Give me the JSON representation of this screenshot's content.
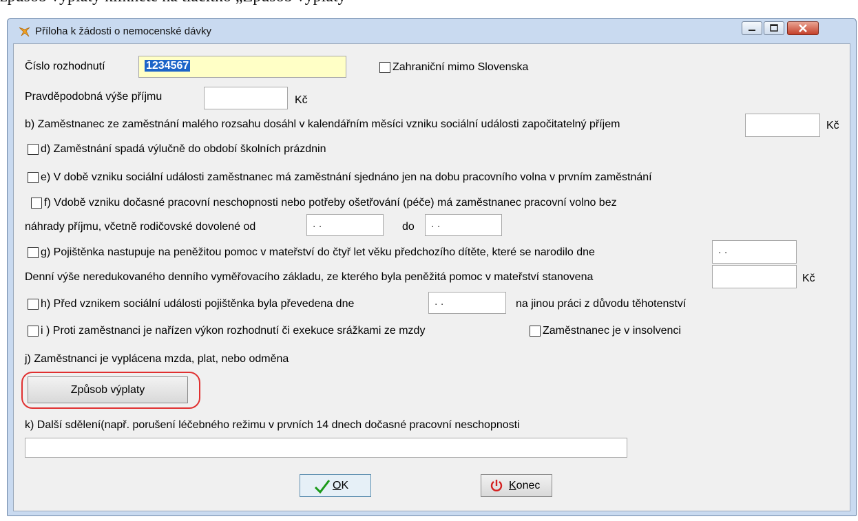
{
  "document_caption": "způsob výplaty klikněte na tlačítko „Způsob výplaty“",
  "window": {
    "title": "Příloha k žádosti o nemocenské dávky",
    "icon": "app-icon"
  },
  "form": {
    "cislo_rozhodnuti_label": "Číslo rozhodnutí",
    "cislo_rozhodnuti_value": "1234567",
    "zahranicni_label": "Zahraniční mimo Slovenska",
    "pravdepodobna_label": "Pravděpodobná výše příjmu",
    "pravdepodobna_unit": "Kč",
    "b_label": "b) Zaměstnanec ze zaměstnání malého rozsahu dosáhl v kalendářním měsíci vzniku sociální události započitatelný příjem",
    "b_unit": "Kč",
    "d_label": "d) Zaměstnání spadá výlučně do období školních prázdnin",
    "e_label": "e) V době vzniku sociální události zaměstnanec má zaměstnání sjednáno jen na dobu pracovního volna v prvním zaměstnání",
    "f_label_line1": "f) Vdobě vzniku dočasné pracovní neschopnosti nebo potřeby ošetřování (péče) má zaměstnanec pracovní volno bez",
    "f_label_line2": "náhrady příjmu, včetně rodičovské dovolené od",
    "f_od_value": ". .",
    "f_do_label": "do",
    "f_do_value": ". .",
    "g_label": "g) Pojištěnka nastupuje na peněžitou pomoc v mateřství do čtyř let věku předchozího dítěte, které se narodilo dne",
    "g_date_value": ". .",
    "g_denni_label": "Denní výše neredukovaného denního vyměřovacího základu, ze kterého byla peněžitá pomoc v mateřství stanovena",
    "g_denni_unit": "Kč",
    "h_label": "h) Před vznikem sociální události pojištěnka byla převedena dne",
    "h_date_value": ". .",
    "h_suffix": "na jinou práci z důvodu těhotenství",
    "i_label": "i ) Proti zaměstnanci je nařízen výkon rozhodnutí či exekuce srážkami ze mzdy",
    "insolvence_label": "Zaměstnanec je v insolvenci",
    "j_label": "j) Zaměstnanci je vyplácena mzda, plat, nebo odměna",
    "zpusob_button": "Způsob výplaty",
    "k_label": "k) Další sdělení(např. porušení léčebného režimu v prvních 14 dnech dočasné pracovní neschopnosti",
    "k_value": ""
  },
  "buttons": {
    "ok_label": "OK",
    "ok_mnemonic": "O",
    "ok_rest": "K",
    "konec_mnemonic": "K",
    "konec_rest": "onec",
    "ok_icon": "checkmark-icon",
    "konec_icon": "power-icon"
  },
  "colors": {
    "window_frame": "#c9daf0",
    "client_bg": "#f0f0f0",
    "highlight": "#e03030",
    "ok_check": "#1a9a1a",
    "power_icon": "#d42020"
  }
}
